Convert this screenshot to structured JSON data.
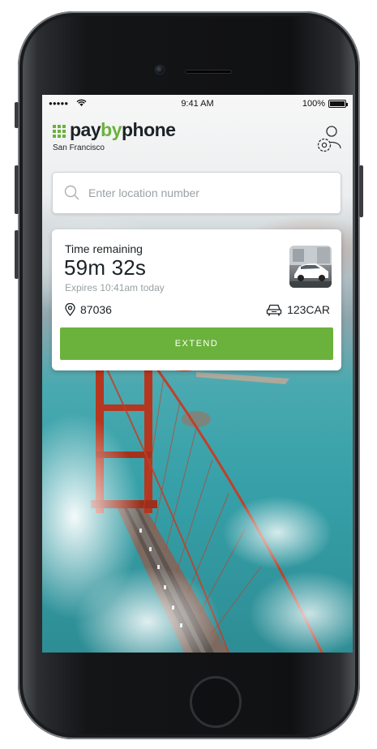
{
  "status_bar": {
    "signal": "●●●●●",
    "time": "9:41 AM",
    "battery": "100%"
  },
  "header": {
    "brand_pay": "pay",
    "brand_by": "by",
    "brand_phone": "phone",
    "city": "San Francisco",
    "settings_icon": "user-settings-icon"
  },
  "search": {
    "placeholder": "Enter location number",
    "value": ""
  },
  "session": {
    "label": "Time remaining",
    "remaining": "59m 32s",
    "expires": "Expires 10:41am today",
    "location_number": "87036",
    "plate": "123CAR",
    "extend_label": "EXTEND"
  },
  "colors": {
    "brand_green": "#6bb23c",
    "text_dark": "#1c2226",
    "text_muted": "#9aa1a4"
  }
}
